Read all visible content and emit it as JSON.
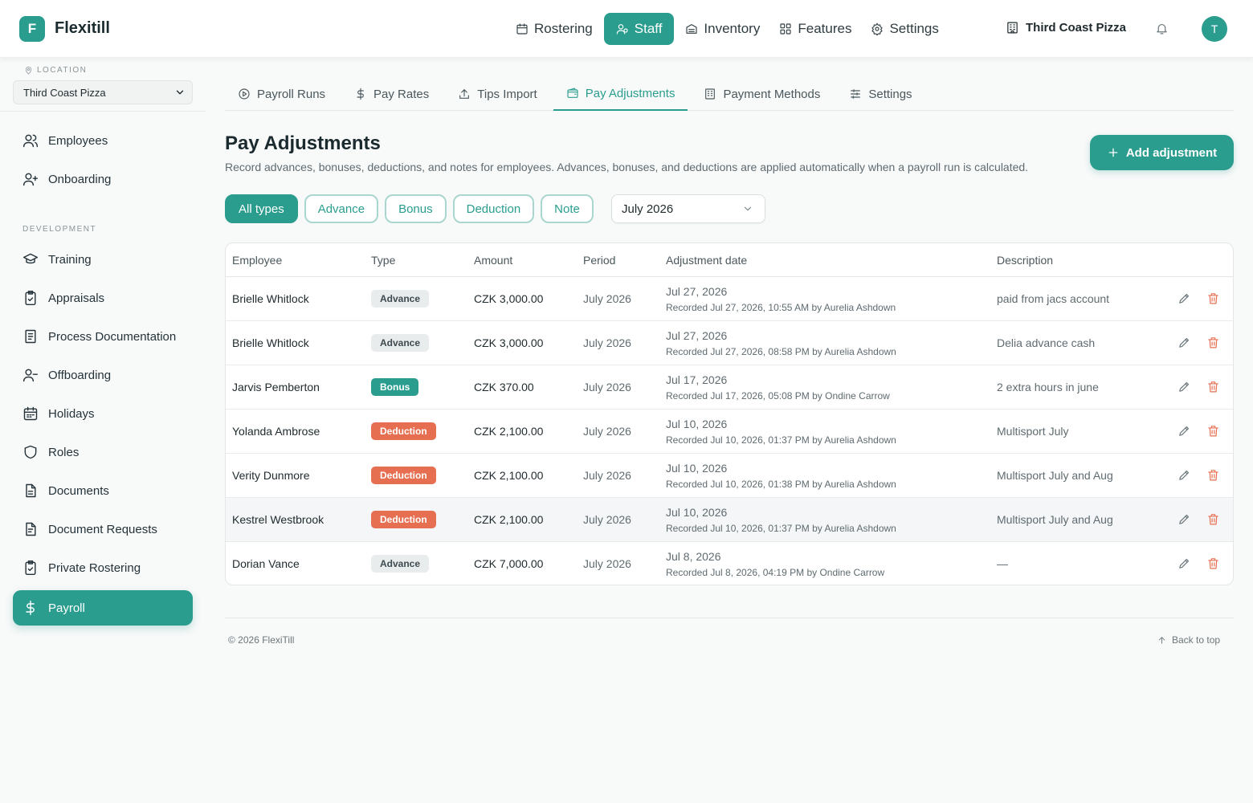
{
  "app": {
    "logo_letter": "F",
    "name": "Flexitill"
  },
  "topnav": [
    {
      "label": "Rostering",
      "icon": "calendar-icon"
    },
    {
      "label": "Staff",
      "icon": "users-icon",
      "active": true
    },
    {
      "label": "Inventory",
      "icon": "inventory-icon"
    },
    {
      "label": "Features",
      "icon": "grid-icon"
    },
    {
      "label": "Settings",
      "icon": "gear-icon"
    }
  ],
  "store": {
    "name": "Third Coast Pizza",
    "icon": "building-icon"
  },
  "user": {
    "initial": "T"
  },
  "sidebar": {
    "location_label": "LOCATION",
    "location_value": "Third Coast Pizza",
    "section_label": "DEVELOPMENT",
    "items": [
      {
        "label": "Employees",
        "icon": "users-icon"
      },
      {
        "label": "Onboarding",
        "icon": "user-plus-icon"
      },
      {
        "label": "Training",
        "icon": "graduation-cap-icon"
      },
      {
        "label": "Appraisals",
        "icon": "clipboard-check-icon"
      },
      {
        "label": "Process Documentation",
        "icon": "book-icon"
      },
      {
        "label": "Offboarding",
        "icon": "user-minus-icon"
      },
      {
        "label": "Holidays",
        "icon": "calendar-days-icon"
      },
      {
        "label": "Roles",
        "icon": "shield-icon"
      },
      {
        "label": "Documents",
        "icon": "file-icon"
      },
      {
        "label": "Document Requests",
        "icon": "file-request-icon"
      },
      {
        "label": "Private Rostering",
        "icon": "clipboard-check-icon"
      },
      {
        "label": "Payroll",
        "icon": "dollar-icon",
        "active": true
      }
    ]
  },
  "subtabs": [
    {
      "label": "Payroll Runs",
      "icon": "play-circle-icon"
    },
    {
      "label": "Pay Rates",
      "icon": "dollar-icon"
    },
    {
      "label": "Tips Import",
      "icon": "upload-icon"
    },
    {
      "label": "Pay Adjustments",
      "icon": "wallet-icon",
      "active": true
    },
    {
      "label": "Payment Methods",
      "icon": "building-icon"
    },
    {
      "label": "Settings",
      "icon": "sliders-icon"
    }
  ],
  "page": {
    "title": "Pay Adjustments",
    "description": "Record advances, bonuses, deductions, and notes for employees. Advances, bonuses, and deductions are applied automatically when a payroll run is calculated.",
    "add_button": "Add adjustment"
  },
  "filters": {
    "chips": [
      "All types",
      "Advance",
      "Bonus",
      "Deduction",
      "Note"
    ],
    "active_chip": "All types",
    "month": "July 2026"
  },
  "table": {
    "headers": [
      "Employee",
      "Type",
      "Amount",
      "Period",
      "Adjustment date",
      "Description"
    ],
    "rows": [
      {
        "employee": "Brielle Whitlock",
        "type": "Advance",
        "amount": "CZK 3,000.00",
        "period": "July 2026",
        "date": "Jul 27, 2026",
        "recorded": "Recorded Jul 27, 2026, 10:55 AM by Aurelia Ashdown",
        "description": "paid from jacs account"
      },
      {
        "employee": "Brielle Whitlock",
        "type": "Advance",
        "amount": "CZK 3,000.00",
        "period": "July 2026",
        "date": "Jul 27, 2026",
        "recorded": "Recorded Jul 27, 2026, 08:58 PM by Aurelia Ashdown",
        "description": "Delia advance cash"
      },
      {
        "employee": "Jarvis Pemberton",
        "type": "Bonus",
        "amount": "CZK 370.00",
        "period": "July 2026",
        "date": "Jul 17, 2026",
        "recorded": "Recorded Jul 17, 2026, 05:08 PM by Ondine Carrow",
        "description": "2 extra hours in june"
      },
      {
        "employee": "Yolanda Ambrose",
        "type": "Deduction",
        "amount": "CZK 2,100.00",
        "period": "July 2026",
        "date": "Jul 10, 2026",
        "recorded": "Recorded Jul 10, 2026, 01:37 PM by Aurelia Ashdown",
        "description": "Multisport July"
      },
      {
        "employee": "Verity Dunmore",
        "type": "Deduction",
        "amount": "CZK 2,100.00",
        "period": "July 2026",
        "date": "Jul 10, 2026",
        "recorded": "Recorded Jul 10, 2026, 01:38 PM by Aurelia Ashdown",
        "description": "Multisport July and Aug"
      },
      {
        "employee": "Kestrel Westbrook",
        "type": "Deduction",
        "amount": "CZK 2,100.00",
        "period": "July 2026",
        "date": "Jul 10, 2026",
        "recorded": "Recorded Jul 10, 2026, 01:37 PM by Aurelia Ashdown",
        "description": "Multisport July and Aug",
        "highlighted": true
      },
      {
        "employee": "Dorian Vance",
        "type": "Advance",
        "amount": "CZK 7,000.00",
        "period": "July 2026",
        "date": "Jul 8, 2026",
        "recorded": "Recorded Jul 8, 2026, 04:19 PM by Ondine Carrow",
        "description": "—"
      }
    ]
  },
  "footer": {
    "copyright": "© 2026 FlexiTill",
    "back_to_top": "Back to top"
  },
  "colors": {
    "accent": "#2a9d8f",
    "deduction": "#e76f51",
    "advance_bg": "#e9eced"
  }
}
